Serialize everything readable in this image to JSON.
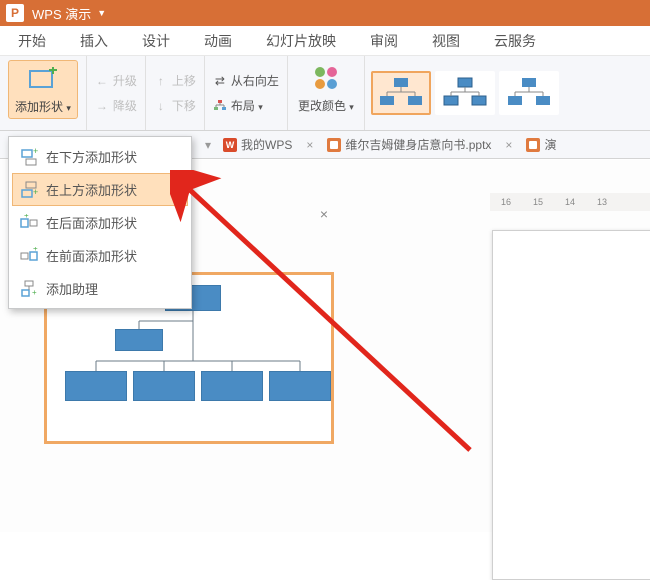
{
  "titlebar": {
    "app_name": "WPS 演示"
  },
  "menu": {
    "items": [
      "开始",
      "插入",
      "设计",
      "动画",
      "幻灯片放映",
      "审阅",
      "视图",
      "云服务"
    ]
  },
  "ribbon": {
    "add_shape": {
      "label": "添加形状"
    },
    "promote": "升级",
    "demote": "降级",
    "move_up": "上移",
    "move_down": "下移",
    "rtl": "从右向左",
    "layout": "布局",
    "change_color": "更改颜色"
  },
  "dropdown": {
    "items": [
      {
        "label": "在下方添加形状",
        "icon": "add-below-icon"
      },
      {
        "label": "在上方添加形状",
        "icon": "add-above-icon"
      },
      {
        "label": "在后面添加形状",
        "icon": "add-after-icon"
      },
      {
        "label": "在前面添加形状",
        "icon": "add-before-icon"
      },
      {
        "label": "添加助理",
        "icon": "add-assistant-icon"
      }
    ],
    "hover_index": 1
  },
  "tabs": {
    "items": [
      {
        "label": "我的WPS",
        "type": "wps"
      },
      {
        "label": "维尔吉姆健身店意向书.pptx",
        "type": "pptx"
      },
      {
        "label": "演",
        "type": "pptx",
        "partial": true
      }
    ]
  },
  "ruler": {
    "ticks": [
      "16",
      "15",
      "14",
      "13"
    ]
  }
}
